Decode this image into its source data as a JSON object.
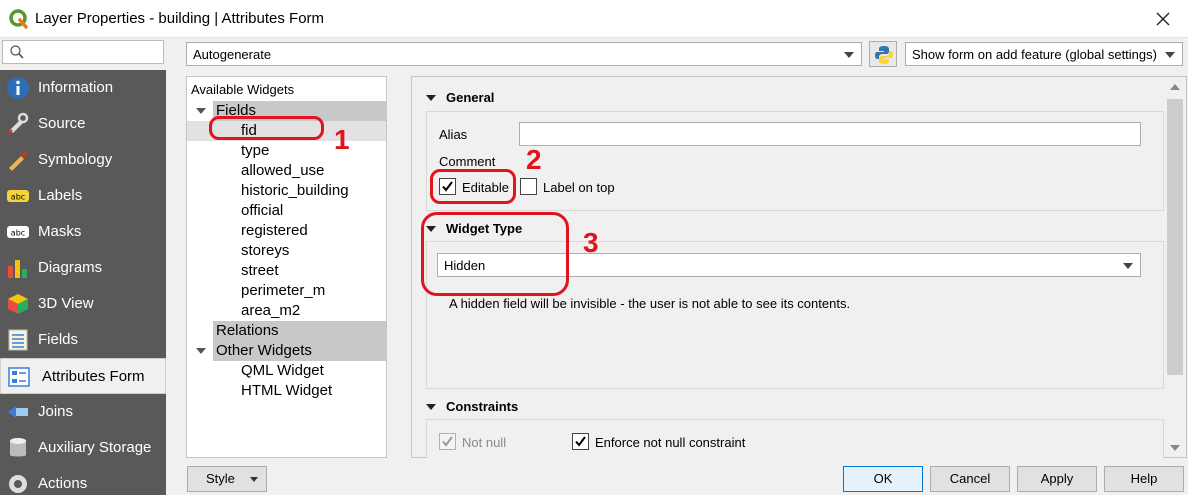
{
  "window": {
    "title": "Layer Properties - building | Attributes Form",
    "app_icon": "qgis-icon",
    "close_icon": "close-icon"
  },
  "sidebar": {
    "search_placeholder": "",
    "items": [
      {
        "label": "Information",
        "icon": "information-icon"
      },
      {
        "label": "Source",
        "icon": "source-icon"
      },
      {
        "label": "Symbology",
        "icon": "symbology-icon"
      },
      {
        "label": "Labels",
        "icon": "labels-icon"
      },
      {
        "label": "Masks",
        "icon": "masks-icon"
      },
      {
        "label": "Diagrams",
        "icon": "diagrams-icon"
      },
      {
        "label": "3D View",
        "icon": "3d-view-icon"
      },
      {
        "label": "Fields",
        "icon": "fields-icon"
      },
      {
        "label": "Attributes Form",
        "icon": "attributes-form-icon"
      },
      {
        "label": "Joins",
        "icon": "joins-icon"
      },
      {
        "label": "Auxiliary Storage",
        "icon": "auxiliary-storage-icon"
      },
      {
        "label": "Actions",
        "icon": "actions-icon"
      }
    ],
    "active_index": 8
  },
  "toolbar": {
    "layout_mode": "Autogenerate",
    "python_icon": "python-icon",
    "show_form_option": "Show form on add feature (global settings)"
  },
  "available_widgets": {
    "header": "Available Widgets",
    "fields_group": "Fields",
    "fields": [
      "fid",
      "type",
      "allowed_use",
      "historic_building",
      "official",
      "registered",
      "storeys",
      "street",
      "perimeter_m",
      "area_m2"
    ],
    "relations_group": "Relations",
    "other_group": "Other Widgets",
    "other": [
      "QML Widget",
      "HTML Widget"
    ]
  },
  "general": {
    "heading": "General",
    "alias_label": "Alias",
    "alias_value": "",
    "comment_label": "Comment",
    "editable_label": "Editable",
    "editable_checked": true,
    "label_on_top_label": "Label on top",
    "label_on_top_checked": false
  },
  "widget_type": {
    "heading": "Widget Type",
    "selected": "Hidden",
    "description": "A hidden field will be invisible - the user is not able to see its contents."
  },
  "constraints": {
    "heading": "Constraints",
    "not_null_label": "Not null",
    "not_null_checked": true,
    "enforce_label": "Enforce not null constraint",
    "enforce_checked": true
  },
  "buttons": {
    "style": "Style",
    "ok": "OK",
    "cancel": "Cancel",
    "apply": "Apply",
    "help": "Help"
  },
  "annotations": {
    "one": "1",
    "two": "2",
    "three": "3",
    "color": "#e0141e"
  },
  "colors": {
    "sidebar_bg": "#595959",
    "group_row_bg": "#c8c8c8",
    "primary_button_border": "#0078d7"
  }
}
